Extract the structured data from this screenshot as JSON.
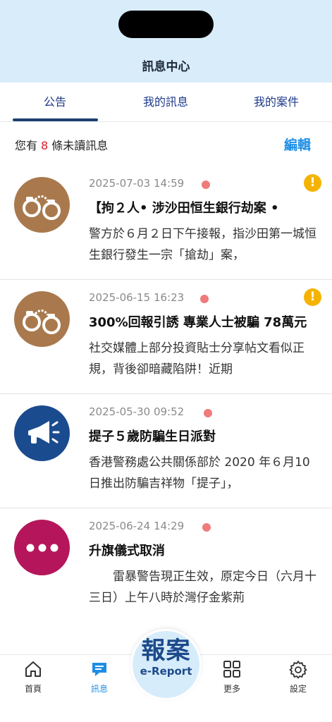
{
  "header": {
    "title": "訊息中心"
  },
  "tabs": [
    {
      "label": "公告",
      "active": true
    },
    {
      "label": "我的訊息",
      "active": false
    },
    {
      "label": "我的案件",
      "active": false
    }
  ],
  "unread": {
    "prefix": "您有",
    "count": "8",
    "suffix": "條未讀訊息",
    "edit_label": "編輯"
  },
  "messages": [
    {
      "date": "2025-07-03 14:59",
      "title": "【拘２人• 涉沙田恒生銀行劫案 •",
      "body": "警方於６月２日下午接報，指沙田第一城恒生銀行發生一宗「搶劫」案，",
      "icon": "handcuffs-icon",
      "important": true,
      "alert_symbol": "!",
      "avatar_color": "#a9794d"
    },
    {
      "date": "2025-06-15 16:23",
      "title": "300%回報引誘 專業人士被騙 78萬元",
      "body": "社交媒體上部分投資貼士分享帖文看似正規，背後卻暗藏陷阱！近期",
      "icon": "handcuffs-icon",
      "important": true,
      "alert_symbol": "!",
      "avatar_color": "#a9794d"
    },
    {
      "date": "2025-05-30 09:52",
      "title": "提子５歲防騙生日派對",
      "body": "香港警務處公共關係部於 2020 年６月10日推出防騙吉祥物「提子」，",
      "icon": "megaphone-icon",
      "important": false,
      "avatar_color": "#1b4b8f"
    },
    {
      "date": "2025-06-24 14:29",
      "title": "升旗儀式取消",
      "body": "　　雷暴警告現正生效，原定今日（六月十三日）上午八時於灣仔金紫荊",
      "icon": "more-dots-icon",
      "important": false,
      "avatar_color": "#b5165b"
    }
  ],
  "bottom_nav": {
    "items": [
      {
        "label": "首頁",
        "icon": "home-icon"
      },
      {
        "label": "訊息",
        "icon": "message-icon",
        "active": true
      },
      {
        "label": "更多",
        "icon": "grid-icon"
      },
      {
        "label": "設定",
        "icon": "gear-icon"
      }
    ],
    "report": {
      "zh": "報案",
      "en": "e-Report"
    }
  },
  "colors": {
    "header_bg": "#d8ecfa",
    "accent_blue": "#1d8ee6",
    "unread_red": "#e11d2e",
    "tab_underline": "#1e3f6e"
  }
}
